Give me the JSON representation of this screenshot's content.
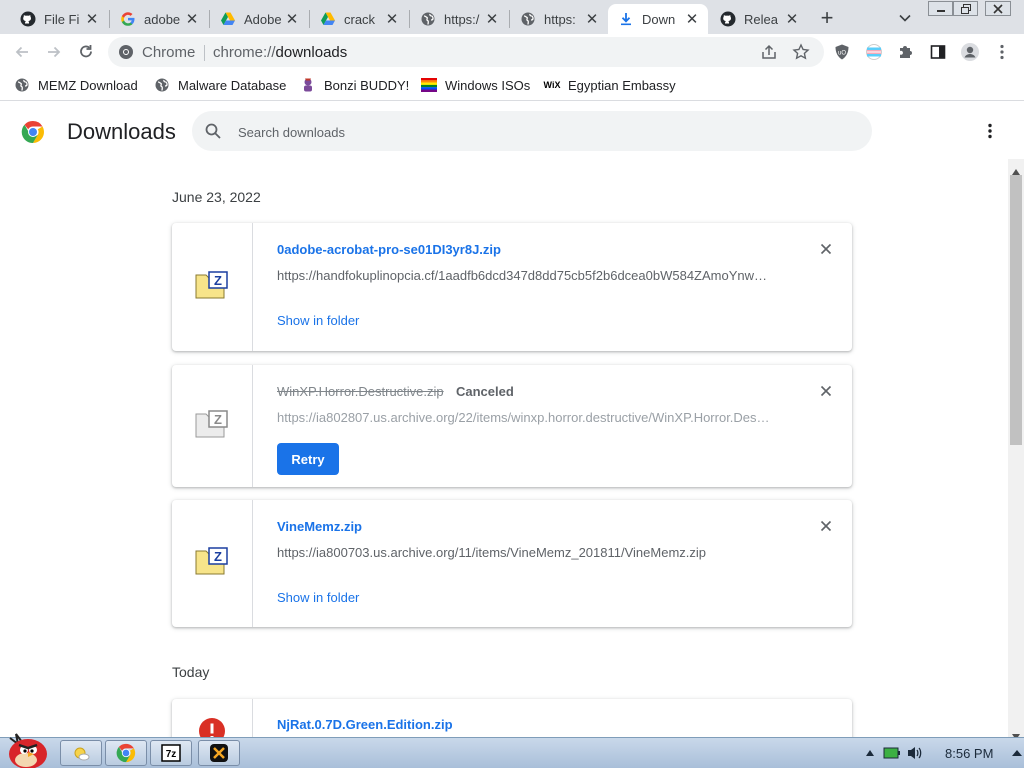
{
  "tabs": [
    {
      "label": "File Fi",
      "icon": "github-icon"
    },
    {
      "label": "adobe",
      "icon": "google-icon"
    },
    {
      "label": "Adobe",
      "icon": "google-drive-icon"
    },
    {
      "label": "crack",
      "icon": "google-drive-icon"
    },
    {
      "label": "https:/",
      "icon": "globe-icon"
    },
    {
      "label": "https:",
      "icon": "globe-icon"
    },
    {
      "label": "Down",
      "icon": "download-icon",
      "active": true
    },
    {
      "label": "Relea",
      "icon": "github-icon"
    }
  ],
  "omnibox": {
    "site_label": "Chrome",
    "url_prefix": "chrome://",
    "url_path": "downloads"
  },
  "bookmarks": [
    {
      "label": "MEMZ Download",
      "icon": "globe-icon"
    },
    {
      "label": "Malware Database",
      "icon": "globe-icon"
    },
    {
      "label": "Bonzi BUDDY!",
      "icon": "bonzi-icon"
    },
    {
      "label": "Windows ISOs",
      "icon": "rainbow-flag-icon"
    },
    {
      "label": "Egyptian Embassy",
      "icon": "wix-icon"
    }
  ],
  "page": {
    "title": "Downloads",
    "search_placeholder": "Search downloads"
  },
  "groups": [
    {
      "date": "June 23, 2022",
      "items": [
        {
          "name": "0adobe-acrobat-pro-se01DI3yr8J.zip",
          "url": "https://handfokuplinopcia.cf/1aadfb6dcd347d8dd75cb5f2b6dcea0bW584ZAmoYnw…",
          "action": "Show in folder",
          "status": "complete"
        },
        {
          "name": "WinXP.Horror.Destructive.zip",
          "status_label": "Canceled",
          "url": "https://ia802807.us.archive.org/22/items/winxp.horror.destructive/WinXP.Horror.Des…",
          "action": "Retry",
          "status": "canceled"
        },
        {
          "name": "VineMemz.zip",
          "url": "https://ia800703.us.archive.org/11/items/VineMemz_201811/VineMemz.zip",
          "action": "Show in folder",
          "status": "complete"
        }
      ]
    },
    {
      "date": "Today",
      "items": [
        {
          "name": "NjRat.0.7D.Green.Edition.zip",
          "status": "dangerous"
        }
      ]
    }
  ],
  "taskbar": {
    "clock": "8:56 PM"
  }
}
